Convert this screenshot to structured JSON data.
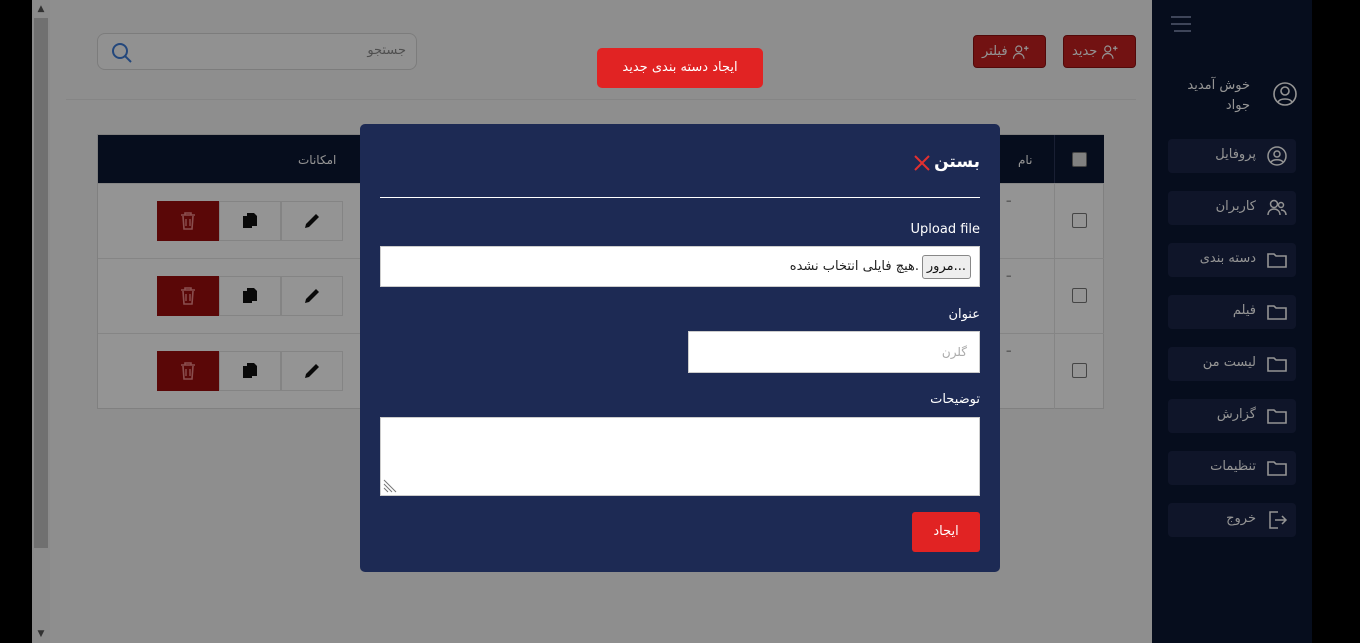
{
  "colors": {
    "accent": "#e12323",
    "sidebar_bg": "#0c1733",
    "modal_bg": "#1d2a54"
  },
  "header": {
    "search_placeholder": "جستجو",
    "filter_label": "فیلتر",
    "new_label": "جدید"
  },
  "table": {
    "columns": {
      "features": "امکانات",
      "name": "نام"
    },
    "rows": [
      {
        "name": "–"
      },
      {
        "name": "–"
      },
      {
        "name": "–"
      }
    ]
  },
  "sidebar": {
    "welcome": "خوش آمدید",
    "username": "جواد",
    "items": [
      {
        "label": "پروفایل",
        "icon": "user-circle-icon"
      },
      {
        "label": "کاربران",
        "icon": "users-icon"
      },
      {
        "label": "دسته بندی",
        "icon": "folder-icon"
      },
      {
        "label": "فیلم",
        "icon": "folder-icon"
      },
      {
        "label": "لیست من",
        "icon": "folder-icon"
      },
      {
        "label": "گزارش",
        "icon": "folder-icon"
      },
      {
        "label": "تنظیمات",
        "icon": "folder-icon"
      },
      {
        "label": "خروج",
        "icon": "logout-icon"
      }
    ]
  },
  "toast": {
    "label": "ایجاد دسته بندی جدید"
  },
  "modal": {
    "close_label": "بستن",
    "upload_label": "Upload file",
    "browse_label": "مرور...",
    "file_status": "هیچ فایلی انتخاب نشده.",
    "title_label": "عنوان",
    "title_placeholder": "گلرن",
    "description_label": "توضیحات",
    "submit_label": "ایجاد"
  }
}
